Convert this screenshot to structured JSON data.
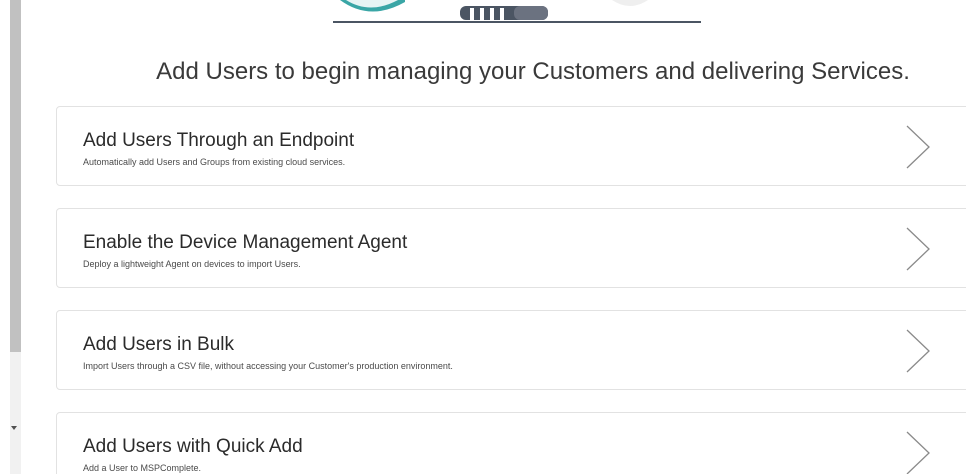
{
  "headline": "Add Users to begin managing your Customers and delivering Services.",
  "options": [
    {
      "title": "Add Users Through an Endpoint",
      "description": "Automatically add Users and Groups from existing cloud services."
    },
    {
      "title": "Enable the Device Management Agent",
      "description": "Deploy a lightweight Agent on devices to import Users."
    },
    {
      "title": "Add Users in Bulk",
      "description": "Import Users through a CSV file, without accessing your Customer's production environment."
    },
    {
      "title": "Add Users with Quick Add",
      "description": "Add a User to MSPComplete."
    }
  ],
  "icons": {
    "chevron": "chevron-right-icon",
    "illustration": "users-illustration"
  },
  "colors": {
    "accent_teal": "#3aa6a6",
    "illustration_dark": "#4b5563",
    "card_border": "#e2e2e2",
    "headline_text": "#3a3a3a"
  }
}
